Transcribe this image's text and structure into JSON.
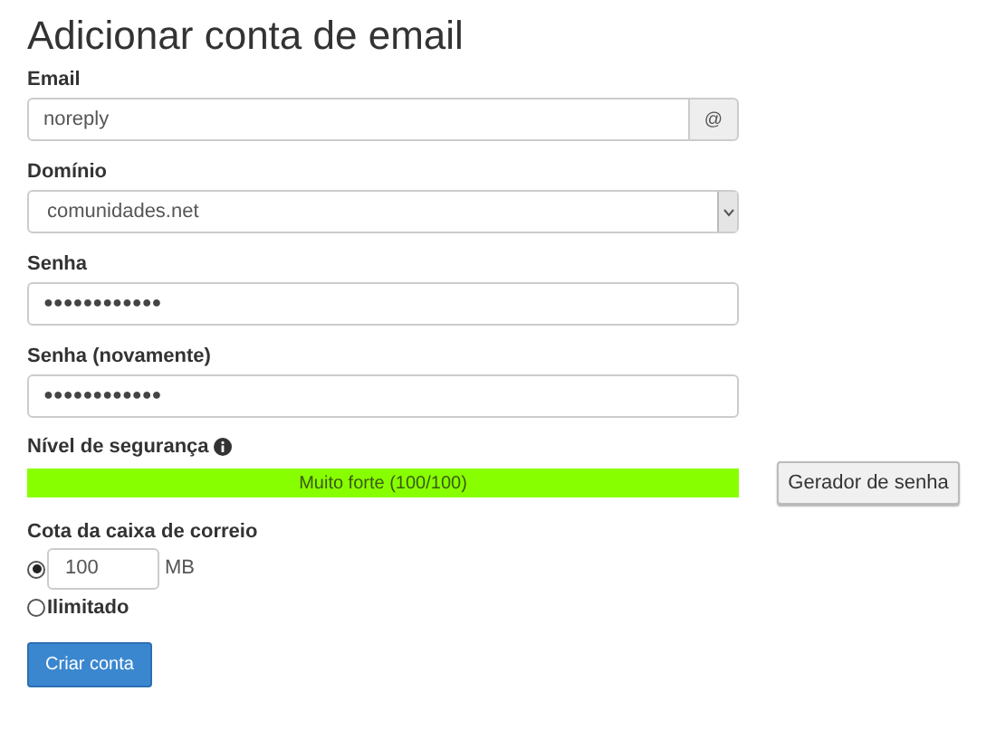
{
  "title": "Adicionar conta de email",
  "email": {
    "label": "Email",
    "value": "noreply",
    "addon": "@"
  },
  "domain": {
    "label": "Domínio",
    "value": "comunidades.net"
  },
  "password": {
    "label": "Senha",
    "value": "●●●●●●●●●●●●"
  },
  "password_again": {
    "label": "Senha (novamente)",
    "value": "●●●●●●●●●●●●"
  },
  "strength": {
    "label": "Nível de segurança",
    "level": 1,
    "text": "Muito forte (100/100)",
    "button": "Gerador de senha"
  },
  "quota": {
    "label": "Cota da caixa de correio",
    "options": [
      {
        "kind": "amount",
        "selected": true,
        "value": "100",
        "unit": "MB"
      },
      {
        "kind": "text",
        "selected": false,
        "label": "Ilimitado"
      }
    ]
  },
  "submit": "Criar conta"
}
